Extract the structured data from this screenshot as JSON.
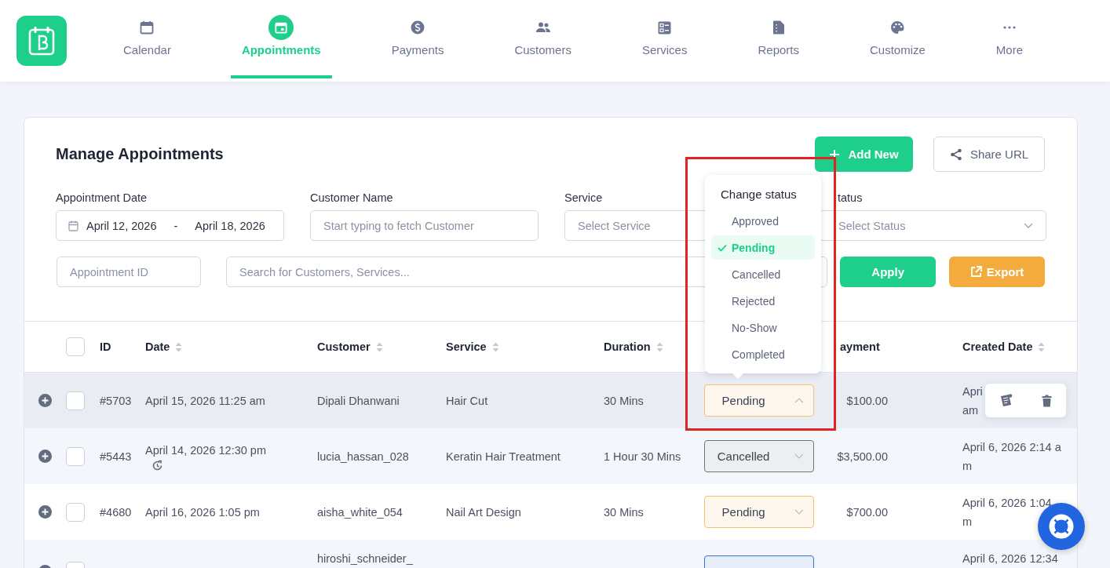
{
  "logo": {
    "kind": "calendar-b"
  },
  "nav": {
    "items": [
      {
        "label": "Calendar",
        "selected": false
      },
      {
        "label": "Appointments",
        "selected": true
      },
      {
        "label": "Payments",
        "selected": false
      },
      {
        "label": "Customers",
        "selected": false
      },
      {
        "label": "Services",
        "selected": false
      },
      {
        "label": "Reports",
        "selected": false
      },
      {
        "label": "Customize",
        "selected": false
      },
      {
        "label": "More",
        "selected": false
      }
    ]
  },
  "page": {
    "title": "Manage Appointments",
    "buttons": [
      {
        "label": "Add New",
        "kind": "primary"
      },
      {
        "label": "Share URL",
        "kind": "outline"
      }
    ]
  },
  "filters": {
    "date": {
      "label": "Appointment Date",
      "from": "April 12, 2026",
      "separator": "-",
      "to": "April 18, 2026"
    },
    "customer": {
      "label": "Customer Name",
      "placeholder": "Start typing to fetch Customer"
    },
    "service": {
      "label": "Service",
      "placeholder": "Select Service"
    },
    "status": {
      "label": "tatus",
      "placeholder": "Select Status"
    },
    "appointment_id": {
      "placeholder": "Appointment ID"
    },
    "search": {
      "placeholder": "Search for Customers, Services..."
    },
    "buttons": [
      {
        "label": "Apply",
        "kind": "apply"
      },
      {
        "label": "Export",
        "kind": "export"
      }
    ]
  },
  "table": {
    "select_all": {
      "checked": false
    },
    "columns": [
      {
        "label": "ID",
        "sortable": false
      },
      {
        "label": "Date",
        "sortable": true
      },
      {
        "label": "Customer",
        "sortable": true
      },
      {
        "label": "Service",
        "sortable": true
      },
      {
        "label": "Duration",
        "sortable": true
      },
      {
        "label": "ayment",
        "sortable": false
      },
      {
        "label": "Created Date",
        "sortable": true
      }
    ],
    "rows": [
      {
        "checked": false,
        "hovered": true,
        "id": "#5703",
        "date": "April 15, 2026 11:25 am",
        "recurring": false,
        "customer": [
          "Dipali Dhanwani"
        ],
        "service": "Hair Cut",
        "duration": "30 Mins",
        "status": "Pending",
        "color": "#f5c070",
        "open": true,
        "payment": "$100.00",
        "created": [
          "Apri",
          "am"
        ]
      },
      {
        "checked": false,
        "hovered": false,
        "id": "#5443",
        "date": "April 14, 2026 12:30 pm",
        "recurring": true,
        "customer": [
          "lucia_hassan_028"
        ],
        "service": "Keratin Hair Treatment",
        "duration": "1 Hour 30 Mins",
        "status": "Cancelled",
        "color": "#6b7280",
        "open": false,
        "payment": "$3,500.00",
        "created": [
          "April 6, 2026 2:14 a",
          "m"
        ]
      },
      {
        "checked": false,
        "hovered": false,
        "id": "#4680",
        "date": "April 16, 2026 1:05 pm",
        "recurring": false,
        "customer": [
          "aisha_white_054"
        ],
        "service": "Nail Art Design",
        "duration": "30 Mins",
        "status": "Pending",
        "color": "#f5c070",
        "open": false,
        "payment": "$700.00",
        "created": [
          "April 6, 2026 1:04",
          "m"
        ]
      },
      {
        "checked": false,
        "hovered": false,
        "recurring": false,
        "customer": [
          "hiroshi_schneider_"
        ],
        "color": "#3b74d8",
        "created": [
          "April 6, 2026 12:34"
        ]
      }
    ]
  },
  "status_menu": {
    "title": "Change status",
    "options": [
      {
        "label": "Approved",
        "selected": false
      },
      {
        "label": "Pending",
        "selected": true
      },
      {
        "label": "Cancelled",
        "selected": false
      },
      {
        "label": "Rejected",
        "selected": false
      },
      {
        "label": "No-Show",
        "selected": false
      },
      {
        "label": "Completed",
        "selected": false
      }
    ]
  },
  "highlight": true,
  "help_button": true
}
